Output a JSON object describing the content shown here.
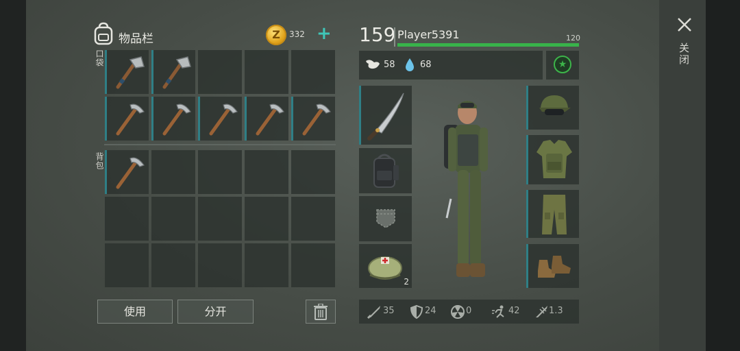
{
  "inventory": {
    "title": "物品栏",
    "coins": "332",
    "coin_symbol": "Z",
    "add_icon": "+",
    "pocket_label": "口袋",
    "bag_label": "背包",
    "pocket_slots": [
      "hatchet",
      "hatchet",
      "empty",
      "empty",
      "empty",
      "pickaxe",
      "pickaxe",
      "pickaxe",
      "pickaxe",
      "pickaxe"
    ],
    "bag_slots": [
      "pickaxe",
      "empty",
      "empty",
      "empty",
      "empty",
      "empty",
      "empty",
      "empty",
      "empty",
      "empty",
      "empty",
      "empty",
      "empty",
      "empty",
      "empty"
    ]
  },
  "actions": {
    "use_label": "使用",
    "split_label": "分开",
    "trash_icon": "trash-icon"
  },
  "character": {
    "hp": "159",
    "name": "Player5391",
    "level": "120",
    "food": "58",
    "water": "68",
    "star_icon": "★",
    "left_equipment": [
      {
        "item": "machete",
        "count": ""
      },
      {
        "item": "backpack",
        "count": ""
      },
      {
        "item": "pocket-empty",
        "count": ""
      },
      {
        "item": "medkit-bag",
        "count": "2"
      }
    ],
    "right_equipment": [
      "cap",
      "vest",
      "pants",
      "boots"
    ]
  },
  "stats": {
    "attack": "35",
    "defense": "24",
    "radiation": "0",
    "speed": "42",
    "damage_mult": "1.3"
  },
  "close": {
    "icon": "close-icon",
    "label": "关闭"
  },
  "colors": {
    "accent": "#2f7f86",
    "xp": "#38b34a",
    "coin": "#e0a21a",
    "add": "#3fc6b8"
  }
}
